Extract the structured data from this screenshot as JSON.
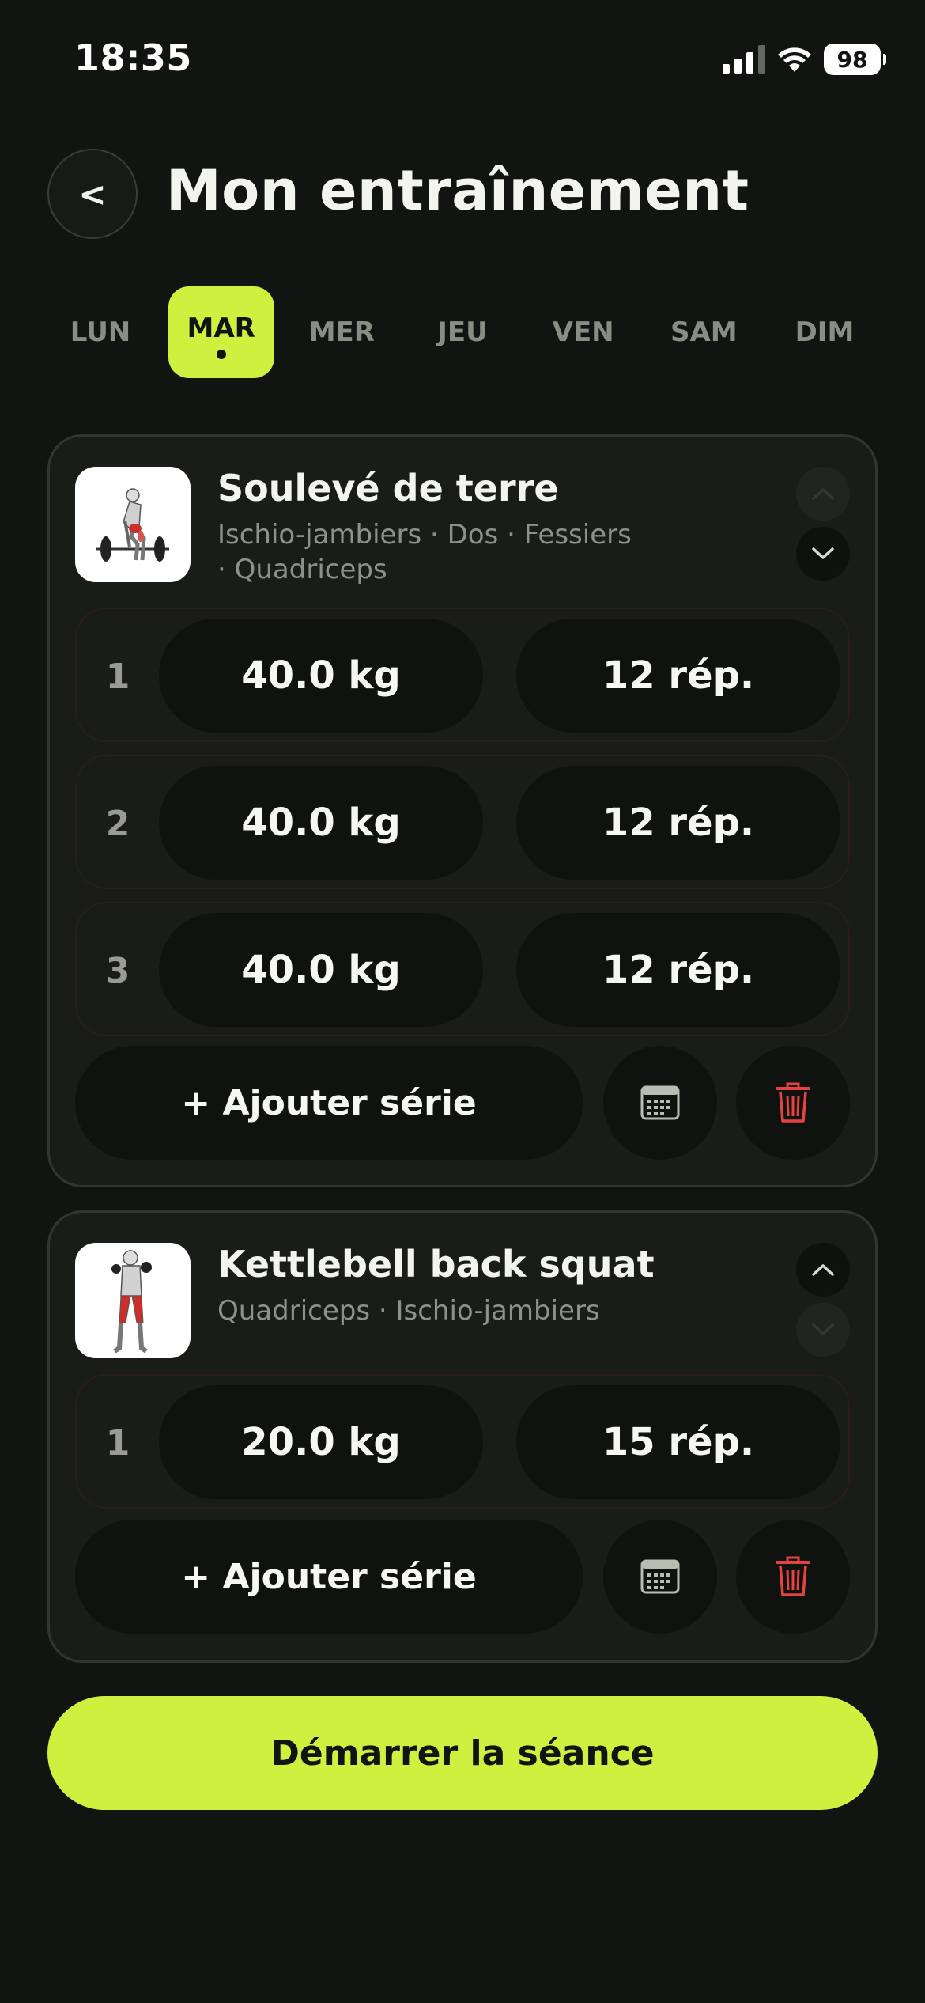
{
  "status_bar": {
    "time": "18:35",
    "battery": "98"
  },
  "header": {
    "title": "Mon entraînement",
    "back_label": "<"
  },
  "days": [
    {
      "label": "LUN",
      "active": false
    },
    {
      "label": "MAR",
      "active": true
    },
    {
      "label": "MER",
      "active": false
    },
    {
      "label": "JEU",
      "active": false
    },
    {
      "label": "VEN",
      "active": false
    },
    {
      "label": "SAM",
      "active": false
    },
    {
      "label": "DIM",
      "active": false
    }
  ],
  "exercises": [
    {
      "name": "Soulevé de terre",
      "muscles_line1": "Ischio-jambiers · Dos · Fessiers",
      "muscles_line2": "· Quadriceps",
      "sets": [
        {
          "number": "1",
          "weight": "40.0 kg",
          "reps": "12 rép."
        },
        {
          "number": "2",
          "weight": "40.0 kg",
          "reps": "12 rép."
        },
        {
          "number": "3",
          "weight": "40.0 kg",
          "reps": "12 rép."
        }
      ],
      "add_set_label": "+ Ajouter série",
      "move_up_enabled": false,
      "move_down_enabled": true
    },
    {
      "name": "Kettlebell back squat",
      "muscles_line1": "Quadriceps · Ischio-jambiers",
      "sets": [
        {
          "number": "1",
          "weight": "20.0 kg",
          "reps": "15 rép."
        }
      ],
      "add_set_label": "+ Ajouter série",
      "move_up_enabled": true,
      "move_down_enabled": false
    }
  ],
  "start_button_label": "Démarrer la séance",
  "colors": {
    "accent": "#cdf13e",
    "background": "#121411",
    "card": "#1a1c18",
    "danger": "#e5433f"
  }
}
